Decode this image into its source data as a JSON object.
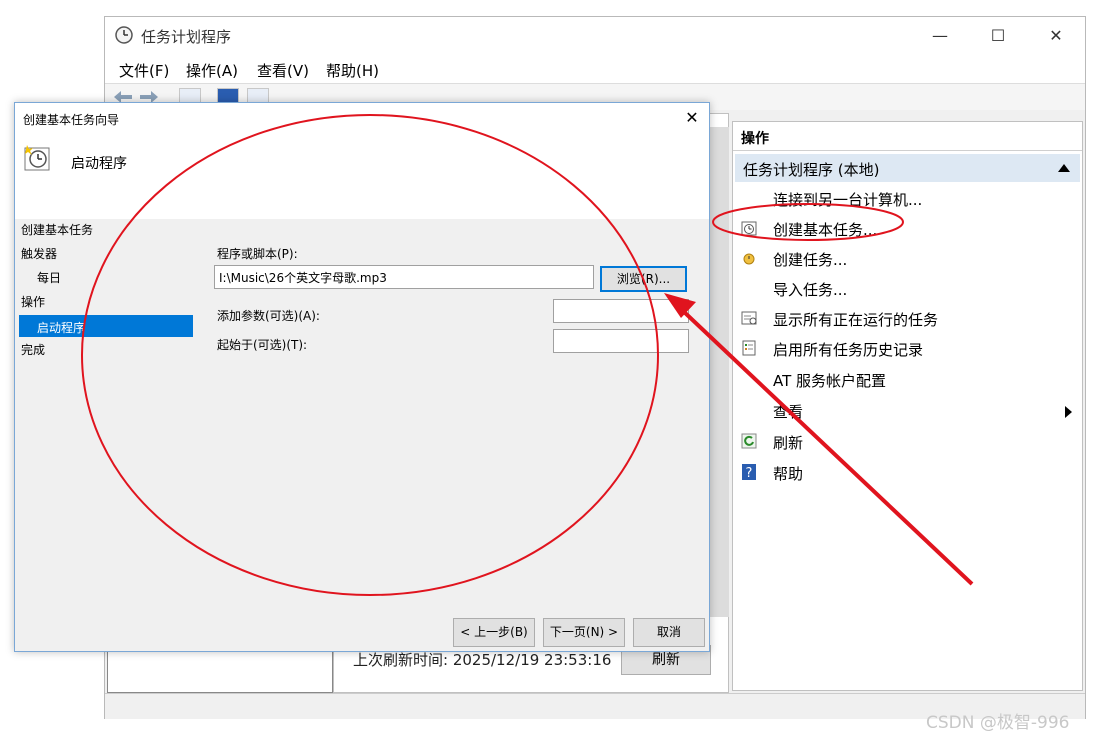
{
  "main_window": {
    "title": "任务计划程序",
    "caption_buttons": {
      "minimize": "—",
      "maximize": "☐",
      "close": "✕"
    },
    "menu": [
      "文件(F)",
      "操作(A)",
      "查看(V)",
      "帮助(H)"
    ],
    "last_refresh_text": "上次刷新时间: 2025/12/19 23:53:16",
    "refresh_button": "刷新"
  },
  "actions_pane": {
    "header": "操作",
    "group_title": "任务计划程序 (本地)",
    "items": [
      {
        "label": "连接到另一台计算机...",
        "icon": "none"
      },
      {
        "label": "创建基本任务...",
        "icon": "clock-wizard-icon"
      },
      {
        "label": "创建任务...",
        "icon": "create-task-icon"
      },
      {
        "label": "导入任务...",
        "icon": "none"
      },
      {
        "label": "显示所有正在运行的任务",
        "icon": "running-tasks-icon"
      },
      {
        "label": "启用所有任务历史记录",
        "icon": "history-icon"
      },
      {
        "label": "AT 服务帐户配置",
        "icon": "none"
      },
      {
        "label": "查看",
        "icon": "none"
      },
      {
        "label": "刷新",
        "icon": "refresh-icon"
      },
      {
        "label": "帮助",
        "icon": "help-icon"
      }
    ]
  },
  "dialog": {
    "title": "创建基本任务向导",
    "close": "✕",
    "heading": "启动程序",
    "steps": [
      "创建基本任务",
      "触发器",
      "每日",
      "操作",
      "启动程序",
      "完成"
    ],
    "selected_step": "启动程序",
    "program_label": "程序或脚本(P):",
    "program_value": "I:\\Music\\26个英文字母歌.mp3",
    "browse_button": "浏览(R)...",
    "args_label": "添加参数(可选)(A):",
    "args_value": "",
    "startin_label": "起始于(可选)(T):",
    "startin_value": "",
    "back_button": "< 上一步(B)",
    "next_button": "下一页(N) >",
    "cancel_button": "取消"
  },
  "annotation_color": "#e0141e",
  "watermark": "CSDN @极智-996"
}
